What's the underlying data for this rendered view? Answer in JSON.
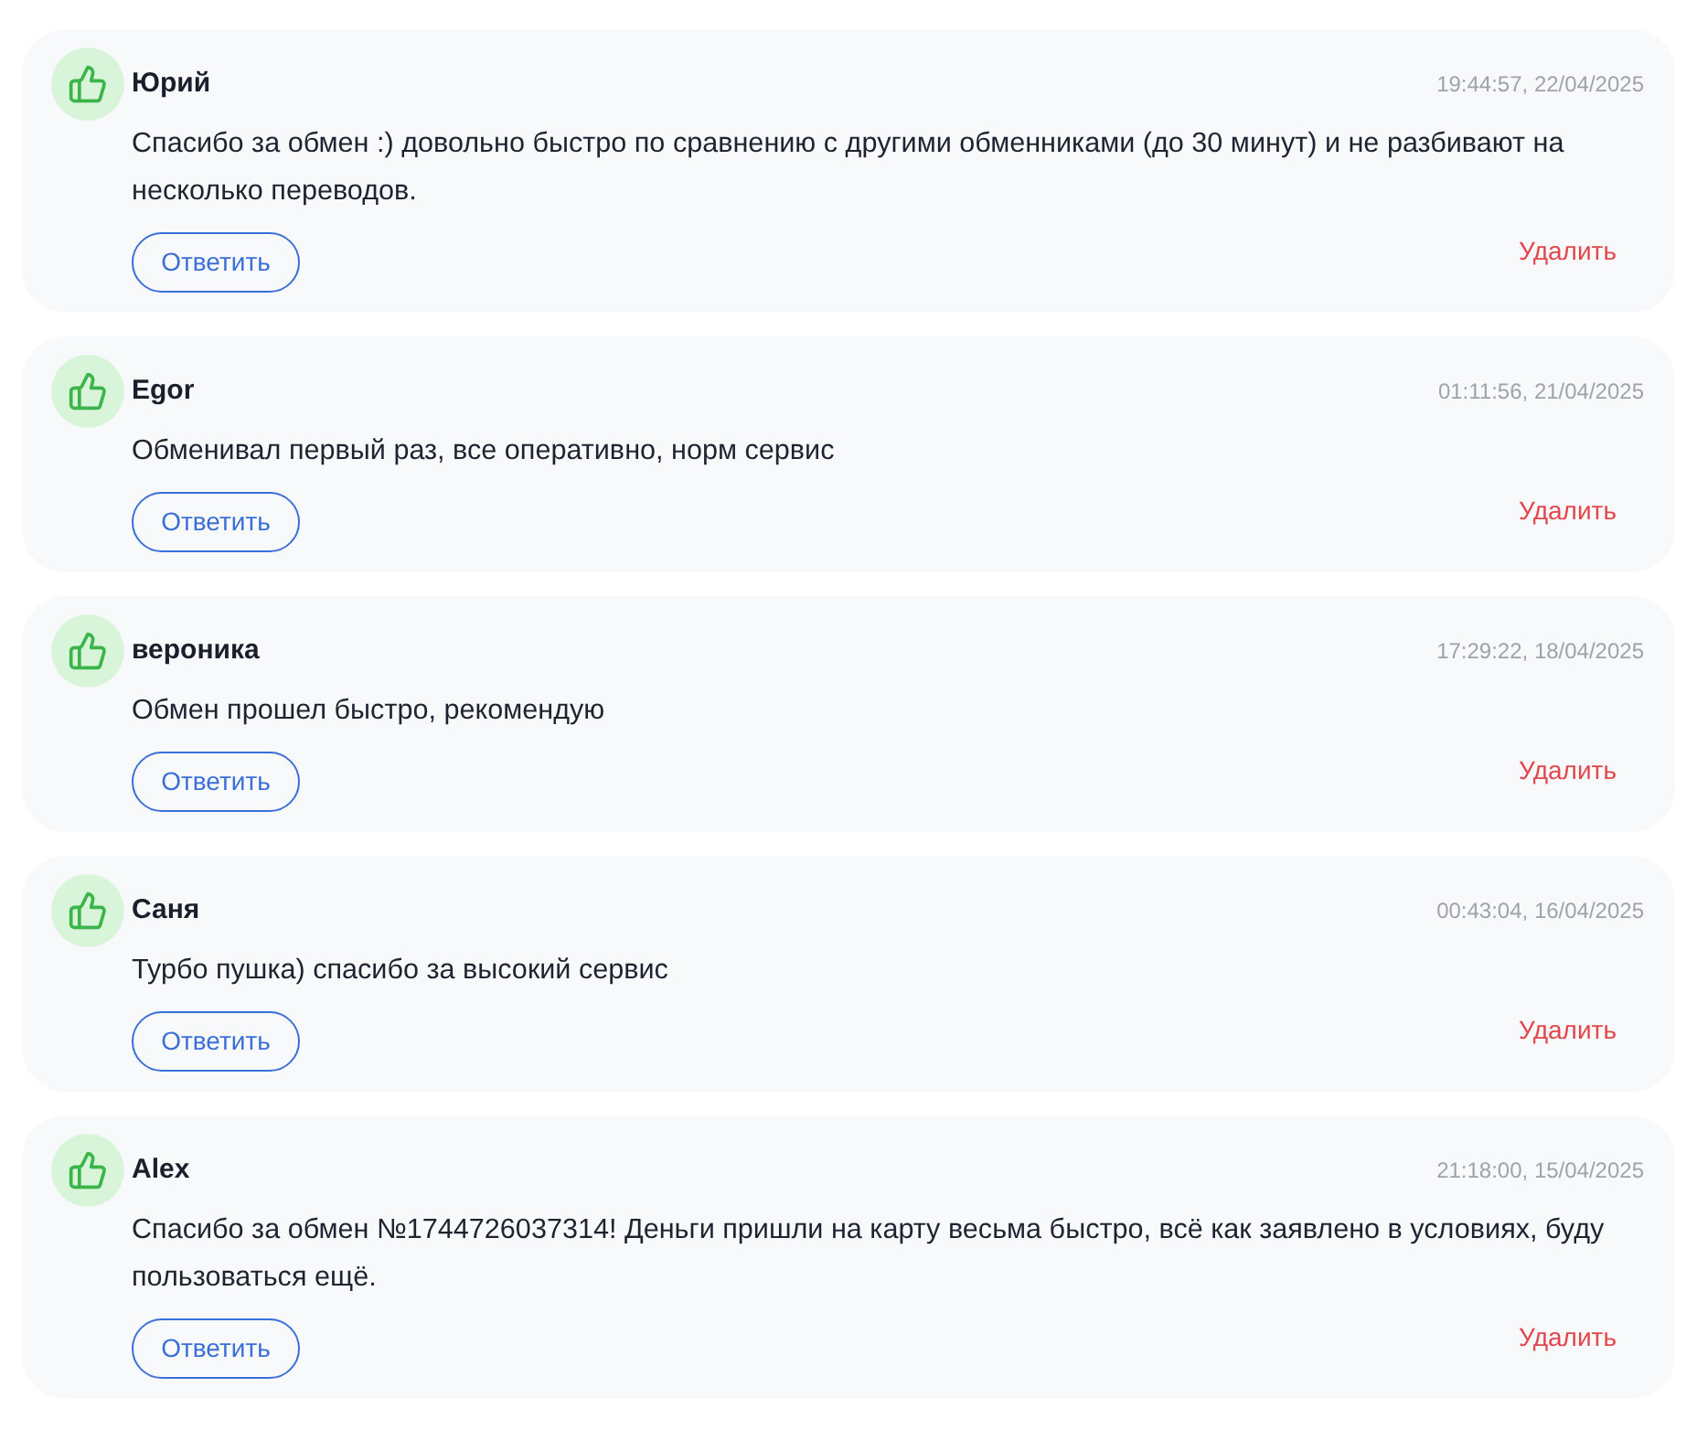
{
  "reviews": [
    {
      "author": "Юрий",
      "date": "19:44:57, 22/04/2025",
      "text": "Спасибо за обмен :) довольно быстро по сравнению с другими обменниками (до 30 минут) и не разбивают на несколько переводов.",
      "reply_button": "Ответить",
      "delete_button": "Удалить"
    },
    {
      "author": "Egor",
      "date": "01:11:56, 21/04/2025",
      "text": "Обменивал первый раз, все оперативно, норм сервис",
      "reply_button": "Ответить",
      "delete_button": "Удалить"
    },
    {
      "author": "вероника",
      "date": "17:29:22, 18/04/2025",
      "text": "Обмен прошел быстро, рекомендую",
      "reply_button": "Ответить",
      "delete_button": "Удалить"
    },
    {
      "author": "Саня",
      "date": "00:43:04, 16/04/2025",
      "text": "Турбо пушка) спасибо за высокий сервис",
      "reply_button": "Ответить",
      "delete_button": "Удалить"
    },
    {
      "author": "Alex",
      "date": "21:18:00, 15/04/2025",
      "text": "Спасибо за обмен №1744726037314! Деньги пришли на карту весьма быстро, всё как заявлено в условиях, буду пользоваться ещё.",
      "reply_button": "Ответить",
      "delete_button": "Удалить"
    }
  ]
}
